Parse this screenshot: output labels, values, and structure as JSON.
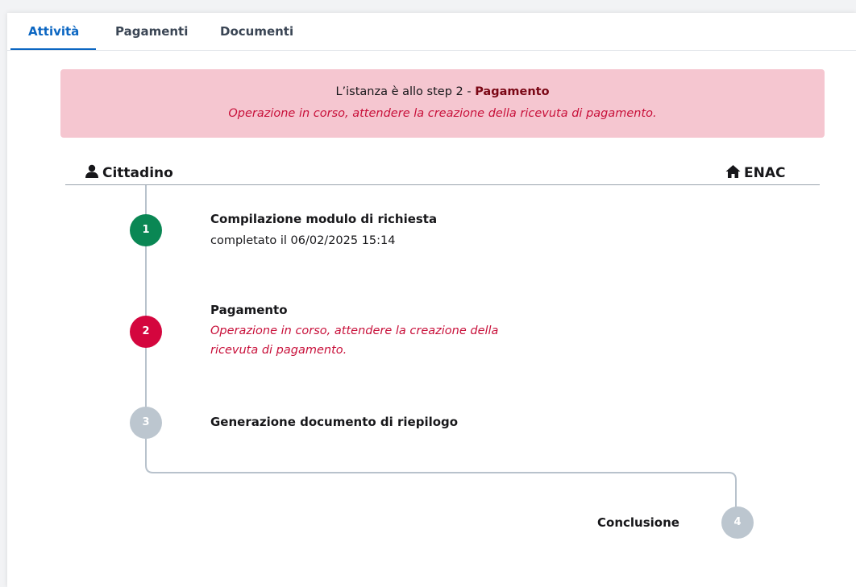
{
  "tabs": [
    {
      "label": "Attività",
      "active": true
    },
    {
      "label": "Pagamenti",
      "active": false
    },
    {
      "label": "Documenti",
      "active": false
    }
  ],
  "alert": {
    "prefix": "L’istanza è allo step 2 - ",
    "step_name": "Pagamento",
    "message": "Operazione in corso, attendere la creazione della ricevuta di pagamento."
  },
  "actors": {
    "left": {
      "label": "Cittadino",
      "icon": "user-icon"
    },
    "right": {
      "label": "ENAC",
      "icon": "home-icon"
    }
  },
  "steps": [
    {
      "number": "1",
      "title": "Compilazione modulo di richiesta",
      "subtitle": "completato il 06/02/2025 15:14",
      "status": "completed",
      "color": "#0a8754"
    },
    {
      "number": "2",
      "title": "Pagamento",
      "subtitle": "Operazione in corso, attendere la creazione della ricevuta di pagamento.",
      "status": "in-progress",
      "color": "#d4063e"
    },
    {
      "number": "3",
      "title": "Generazione documento di riepilogo",
      "subtitle": "",
      "status": "pending",
      "color": "#bcc6cf"
    },
    {
      "number": "4",
      "title": "Conclusione",
      "subtitle": "",
      "status": "pending",
      "color": "#bcc6cf"
    }
  ],
  "colors": {
    "accent": "#0b66c2",
    "alert_bg": "#f5c6d0",
    "alert_text": "#c8103a",
    "timeline": "#b8c2cc"
  }
}
